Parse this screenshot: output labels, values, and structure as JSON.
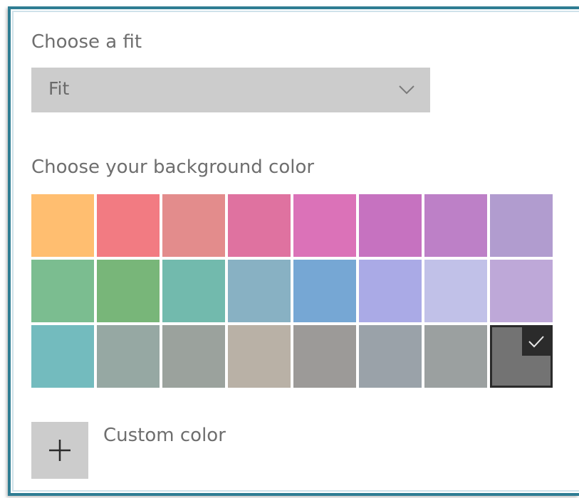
{
  "fit": {
    "label": "Choose a fit",
    "selected": "Fit",
    "chevron_icon": "chevron-down-icon"
  },
  "background": {
    "label": "Choose your background color",
    "selected_index": 23,
    "swatches": [
      "#ffbe70",
      "#f27b82",
      "#e38c8c",
      "#df72a0",
      "#db72b8",
      "#c672c0",
      "#bd80c7",
      "#b19ccf",
      "#7bbd90",
      "#78b679",
      "#72baad",
      "#88b1c3",
      "#76a7d4",
      "#aaaae6",
      "#c1c1e8",
      "#bea8d8",
      "#73bbbe",
      "#96a8a3",
      "#9ba29d",
      "#b9b1a6",
      "#9c9a98",
      "#9aa2a9",
      "#9ba0a0",
      "#737373"
    ],
    "check_icon": "check-icon"
  },
  "custom": {
    "label": "Custom color",
    "icon": "plus-icon"
  }
}
